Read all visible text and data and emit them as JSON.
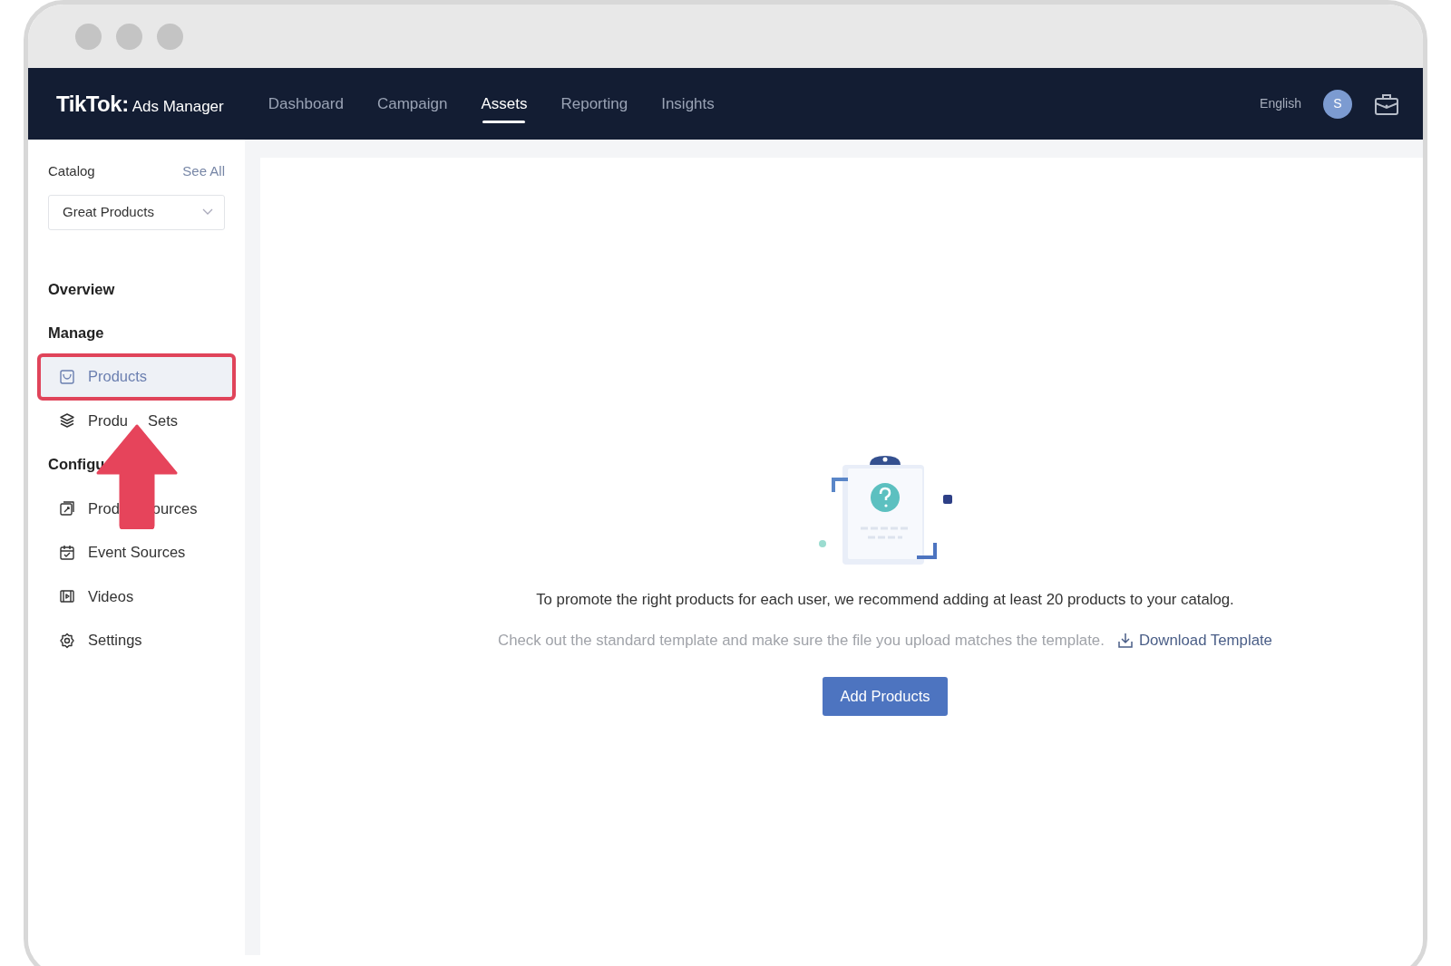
{
  "app": {
    "logo": "TikTok",
    "logo_colon": ":",
    "product": "Ads Manager"
  },
  "nav": [
    {
      "label": "Dashboard",
      "selected": false
    },
    {
      "label": "Campaign",
      "selected": false
    },
    {
      "label": "Assets",
      "selected": true
    },
    {
      "label": "Reporting",
      "selected": false
    },
    {
      "label": "Insights",
      "selected": false
    }
  ],
  "language": "English",
  "avatar": "S",
  "sidebar": {
    "catalog_label": "Catalog",
    "see_all": "See All",
    "catalog_select": "Great Products",
    "sections": [
      {
        "title": "Overview"
      },
      {
        "title": "Manage",
        "items": [
          {
            "label_parts": [
              "Products"
            ],
            "selected": true,
            "annotated": true
          },
          {
            "label_parts": [
              "Produ",
              "Sets"
            ],
            "selected": false,
            "annotated": false
          }
        ]
      },
      {
        "title": "Configu",
        "items": [
          {
            "label_parts": [
              "Prod",
              "ources"
            ],
            "selected": false,
            "annotated": false
          },
          {
            "label_parts": [
              "Event Sources"
            ],
            "selected": false,
            "annotated": false
          },
          {
            "label_parts": [
              "Videos"
            ],
            "selected": false,
            "annotated": false
          },
          {
            "label_parts": [
              "Settings"
            ],
            "selected": false,
            "annotated": false
          }
        ]
      }
    ]
  },
  "empty_state": {
    "message": "To promote the right products for each user, we recommend adding at least 20 products to your catalog.",
    "hint": "Check out the standard template and make sure the file you upload matches the template.",
    "download_link": "Download Template",
    "button": "Add Products"
  }
}
